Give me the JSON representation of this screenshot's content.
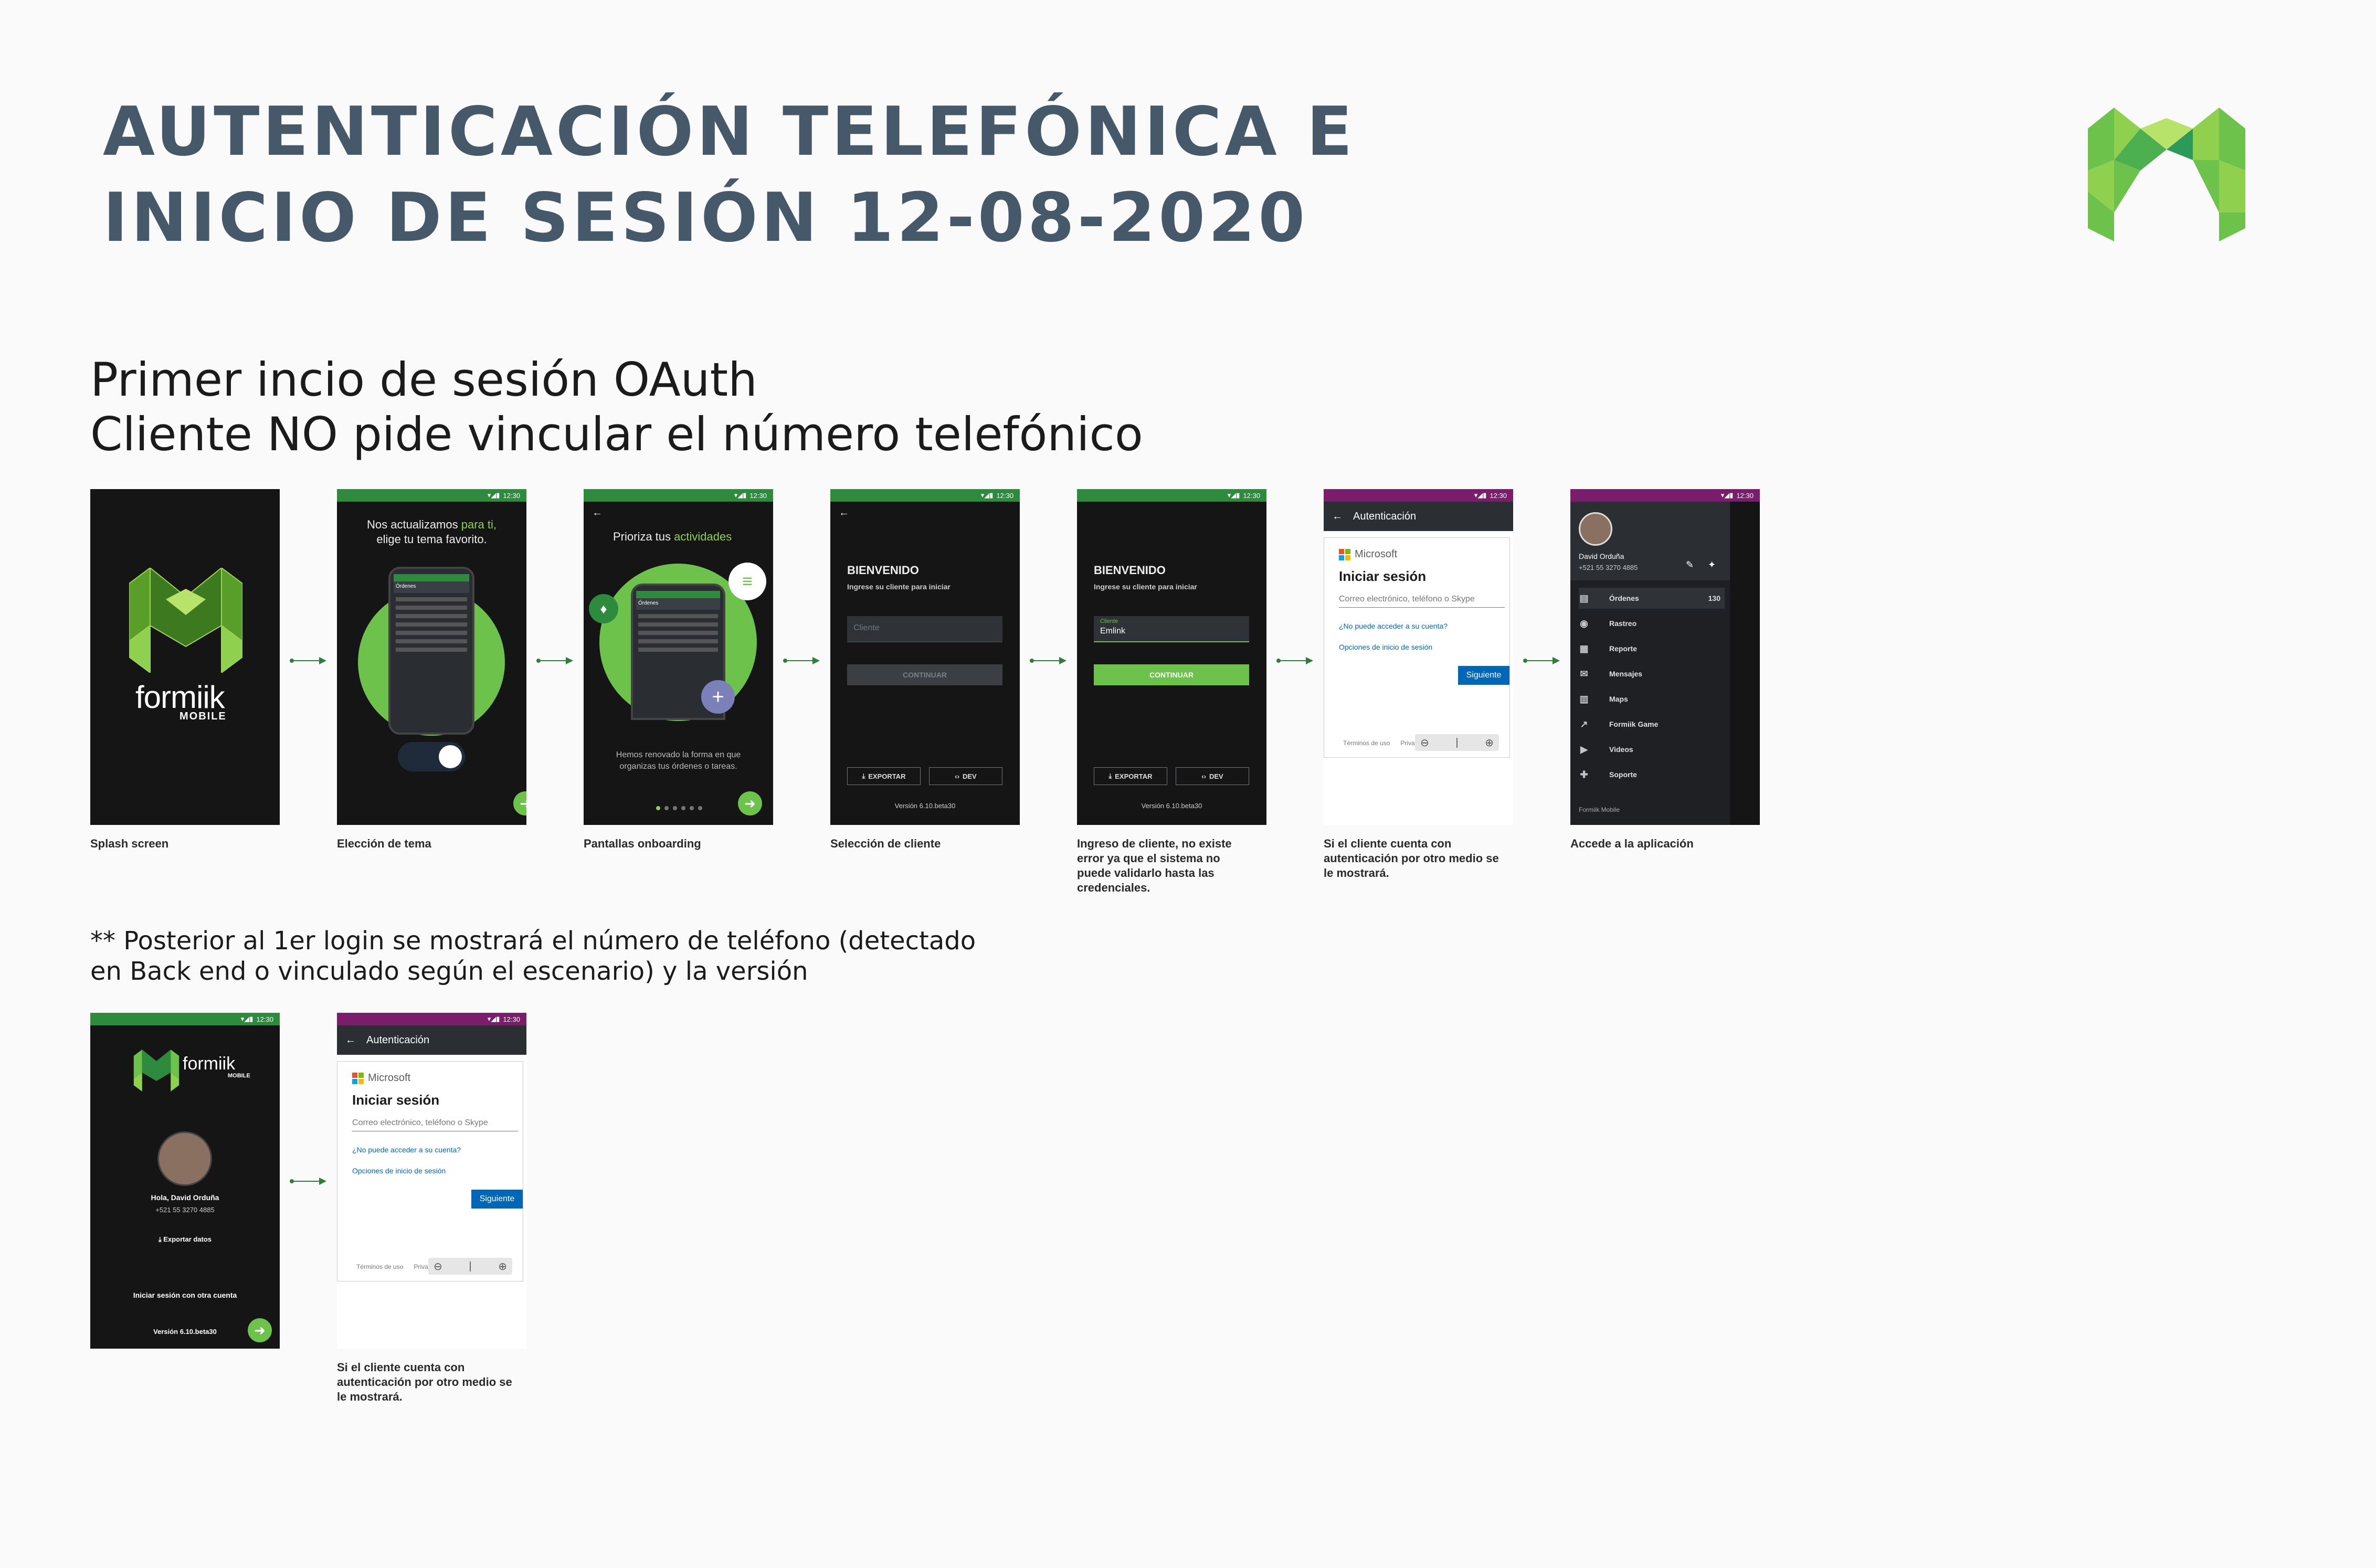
{
  "header": {
    "title_line1": "AUTENTICACIÓN TELEFÓNICA E",
    "title_line2": "INICIO DE SESIÓN 12-08-2020"
  },
  "colors": {
    "brand_green": "#6cc24a",
    "status_green": "#2e8b3d",
    "status_purple": "#7a1d6b",
    "title_slate": "#46596a",
    "ms_blue": "#0067b8"
  },
  "section1": {
    "heading_line1": "Primer incio de sesión OAuth",
    "heading_line2": "Cliente NO pide vincular el número telefónico"
  },
  "status": {
    "time": "12:30"
  },
  "splash": {
    "brand": "formiik",
    "sub": "MOBILE",
    "caption": "Splash screen"
  },
  "theme": {
    "line1": "Nos actualizamos ",
    "accent": "para ti,",
    "line2": "elige tu tema favorito.",
    "caption": "Elección de tema",
    "mini_title": "Órdenes"
  },
  "onboarding": {
    "title": "Prioriza tus ",
    "accent": "actividades",
    "body_line1": "Hemos renovado la forma en que",
    "body_line2": "organizas tus órdenes o tareas.",
    "caption": "Pantallas onboarding",
    "mini_title": "Órdenes"
  },
  "client_select": {
    "welcome": "BIENVENIDO",
    "subtitle": "Ingrese su cliente para iniciar",
    "placeholder": "Cliente",
    "continue": "CONTINUAR",
    "export": "EXPORTAR",
    "dev": "DEV",
    "version": "Versión 6.10.beta30",
    "caption": "Selección de cliente"
  },
  "client_entry": {
    "welcome": "BIENVENIDO",
    "subtitle": "Ingrese su cliente para iniciar",
    "field_label": "Cliente",
    "field_value": "Emlink",
    "continue": "CONTINUAR",
    "export": "EXPORTAR",
    "dev": "DEV",
    "version": "Versión 6.10.beta30",
    "caption": "Ingreso de cliente, no existe error ya que el sistema no puede validarlo hasta las credenciales."
  },
  "auth": {
    "appbar_title": "Autenticación",
    "ms_brand": "Microsoft",
    "signin_title": "Iniciar sesión",
    "input_placeholder": "Correo electrónico, teléfono o Skype",
    "link_access": "¿No puede acceder a su cuenta?",
    "link_options": "Opciones de inicio de sesión",
    "next_button": "Siguiente",
    "terms": "Términos de uso",
    "privacy": "Privac",
    "caption": "Si el cliente cuenta con autenticación por otro medio se le mostrará."
  },
  "drawer": {
    "user_name": "David Orduña",
    "user_phone": "+521 55 3270 4885",
    "items": [
      {
        "label": "Órdenes",
        "badge": "130",
        "icon": "document-icon"
      },
      {
        "label": "Rastreo",
        "icon": "location-icon"
      },
      {
        "label": "Reporte",
        "icon": "report-icon"
      },
      {
        "label": "Mensajes",
        "icon": "mail-icon"
      },
      {
        "label": "Maps",
        "icon": "map-icon"
      },
      {
        "label": "Formiik Game",
        "icon": "trend-icon"
      },
      {
        "label": "Videos",
        "icon": "play-icon"
      },
      {
        "label": "Soporte",
        "icon": "wrench-icon"
      }
    ],
    "footer": "Formiik Mobile",
    "caption": "Accede a la aplicación"
  },
  "note": {
    "line1": "** Posterior al 1er login se mostrará el número de teléfono (detectado",
    "line2": "en Back end o vinculado según el escenario) y la versión"
  },
  "returning": {
    "brand": "formiik",
    "sub": "MOBILE",
    "greeting": "Hola, David Orduña",
    "phone": "+521 55 3270 4885",
    "export": "Exportar datos",
    "other_account": "Iniciar sesión con otra cuenta",
    "version": "Versión 6.10.beta30"
  },
  "auth2": {
    "appbar_title": "Autenticación",
    "ms_brand": "Microsoft",
    "signin_title": "Iniciar sesión",
    "input_placeholder": "Correo electrónico, teléfono o Skype",
    "link_access": "¿No puede acceder a su cuenta?",
    "link_options": "Opciones de inicio de sesión",
    "next_button": "Siguiente",
    "terms": "Términos de uso",
    "privacy": "Privac",
    "caption": "Si el cliente cuenta con autenticación por otro medio se le mostrará."
  }
}
